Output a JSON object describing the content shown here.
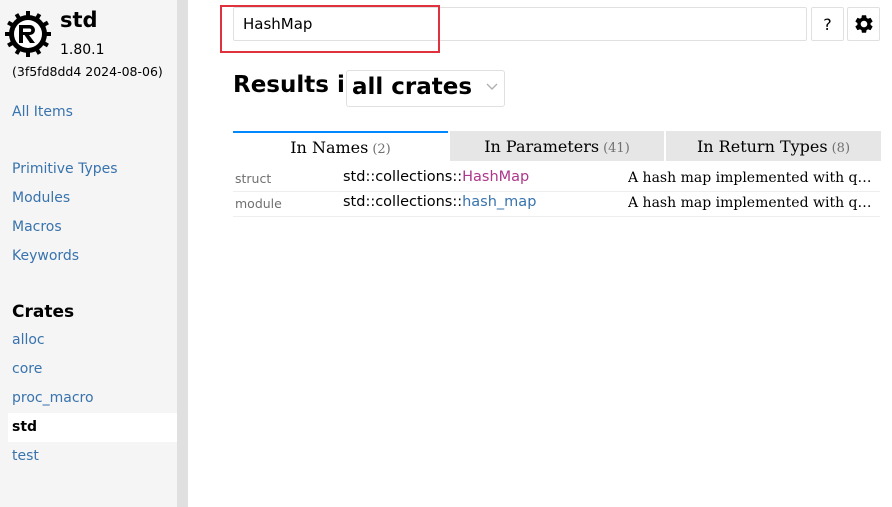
{
  "sidebar": {
    "crate_name": "std",
    "version": "1.80.1",
    "build": "(3f5fd8dd4 2024-08-06)",
    "all_items": "All Items",
    "sections": [
      "Primitive Types",
      "Modules",
      "Macros",
      "Keywords"
    ],
    "crates_heading": "Crates",
    "crates": [
      "alloc",
      "core",
      "proc_macro",
      "std",
      "test"
    ],
    "current_crate": "std"
  },
  "search": {
    "value": "HashMap",
    "help_label": "?",
    "settings_icon": "gear-icon"
  },
  "results": {
    "title": "Results in",
    "crate_filter": "all crates",
    "tabs": [
      {
        "label": "In Names",
        "count": "(2)"
      },
      {
        "label": "In Parameters",
        "count": "(41)"
      },
      {
        "label": "In Return Types",
        "count": "(8)"
      }
    ],
    "rows": [
      {
        "kind": "struct",
        "path_prefix": "std::collections::",
        "name": "HashMap",
        "desc": "A hash map implemented with quadratic probing and SIMD lookup."
      },
      {
        "kind": "module",
        "path_prefix": "std::collections::",
        "name": "hash_map",
        "desc": "A hash map implemented with quadratic probing and SIMD lookup."
      }
    ]
  },
  "colors": {
    "link": "#3873ad",
    "struct": "#ad378a",
    "active_tab_border": "#0089ff",
    "annotation_box": "#e0323e"
  }
}
